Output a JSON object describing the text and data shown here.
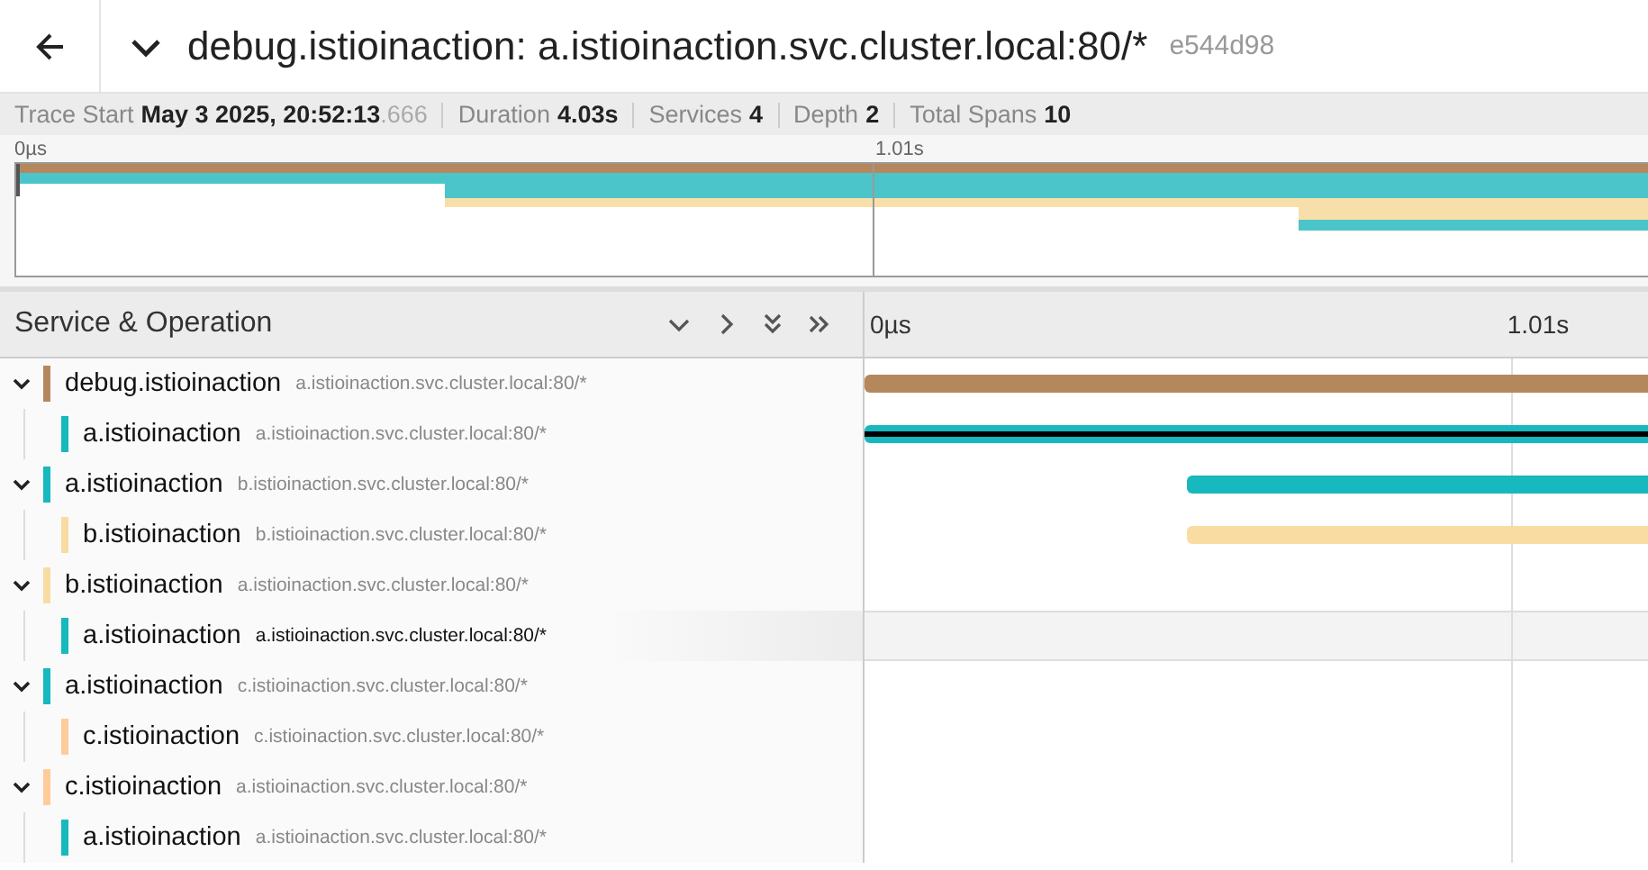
{
  "header": {
    "title": "debug.istioinaction: a.istioinaction.svc.cluster.local:80/*",
    "trace_id": "e544d98",
    "expanded": true
  },
  "summary": [
    {
      "label": "Trace Start",
      "value": "May 3 2025, 20:52:13",
      "fraction": ".666"
    },
    {
      "label": "Duration",
      "value": "4.03s"
    },
    {
      "label": "Services",
      "value": "4"
    },
    {
      "label": "Depth",
      "value": "2"
    },
    {
      "label": "Total Spans",
      "value": "10"
    }
  ],
  "minimap": {
    "ticks": [
      "0µs",
      "1.01s"
    ]
  },
  "table": {
    "column_title": "Service & Operation",
    "timeline_ticks": [
      "0µs",
      "1.01s"
    ],
    "rows": [
      {
        "service": "debug.istioinaction",
        "operation": "a.istioinaction.svc.cluster.local:80/*",
        "color": "#b5875d",
        "expanded": true,
        "hovered": false,
        "children": [
          {
            "service": "a.istioinaction",
            "operation": "a.istioinaction.svc.cluster.local:80/*",
            "color": "#17b8be",
            "hovered": false,
            "critical_path": true
          }
        ]
      },
      {
        "service": "a.istioinaction",
        "operation": "b.istioinaction.svc.cluster.local:80/*",
        "color": "#17b8be",
        "expanded": true,
        "hovered": false,
        "children": [
          {
            "service": "b.istioinaction",
            "operation": "b.istioinaction.svc.cluster.local:80/*",
            "color": "#f8dca1",
            "hovered": false
          }
        ]
      },
      {
        "service": "b.istioinaction",
        "operation": "a.istioinaction.svc.cluster.local:80/*",
        "color": "#f8dca1",
        "expanded": true,
        "hovered": false,
        "children": [
          {
            "service": "a.istioinaction",
            "operation": "a.istioinaction.svc.cluster.local:80/*",
            "color": "#17b8be",
            "hovered": true
          }
        ]
      },
      {
        "service": "a.istioinaction",
        "operation": "c.istioinaction.svc.cluster.local:80/*",
        "color": "#17b8be",
        "expanded": true,
        "hovered": false,
        "children": [
          {
            "service": "c.istioinaction",
            "operation": "c.istioinaction.svc.cluster.local:80/*",
            "color": "#ffcb99",
            "hovered": false
          }
        ]
      },
      {
        "service": "c.istioinaction",
        "operation": "a.istioinaction.svc.cluster.local:80/*",
        "color": "#ffcb99",
        "expanded": true,
        "hovered": false,
        "children": [
          {
            "service": "a.istioinaction",
            "operation": "a.istioinaction.svc.cluster.local:80/*",
            "color": "#17b8be",
            "hovered": false
          }
        ]
      }
    ]
  }
}
